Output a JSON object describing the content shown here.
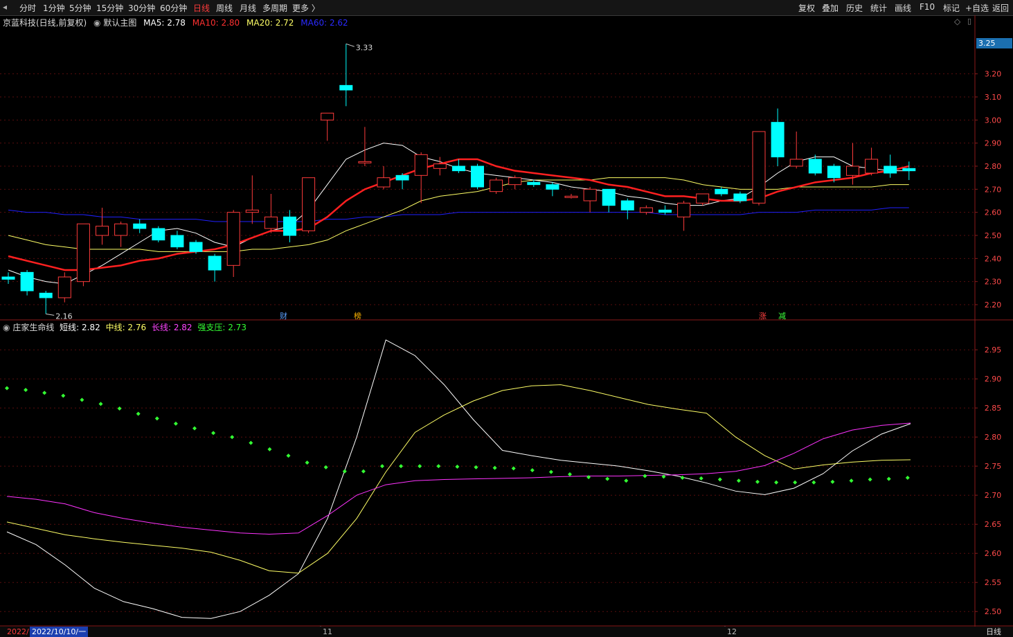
{
  "toolbar": {
    "left_items": [
      "分时",
      "1分钟",
      "5分钟",
      "15分钟",
      "30分钟",
      "60分钟",
      "日线",
      "周线",
      "月线",
      "多周期",
      "更多 〉"
    ],
    "active_item": "日线",
    "right_items": [
      "复权",
      "叠加",
      "历史",
      "统计",
      "画线",
      "F10",
      "标记",
      "+自选",
      "返回"
    ]
  },
  "main_panel": {
    "stock": "京蓝科技(日线,前复权)",
    "template": "默认主图",
    "ma5_label": "MA5: 2.78",
    "ma10_label": "MA10: 2.80",
    "ma20_label": "MA20: 2.72",
    "ma60_label": "MA60: 2.62",
    "high_mark": "3.33",
    "low_mark": "2.16",
    "price_tag": "3.25",
    "badges": [
      {
        "text": "财",
        "color": "#5aa0ff"
      },
      {
        "text": "榜",
        "color": "#ffb400"
      },
      {
        "text": "涨",
        "color": "#ff4040"
      },
      {
        "text": "减",
        "color": "#3cff3c"
      }
    ]
  },
  "sub_panel": {
    "indicator": "庄家生命线",
    "short_label": "短线: 2.82",
    "mid_label": "中线: 2.76",
    "long_label": "长线: 2.82",
    "support_label": "强支压: 2.73"
  },
  "bottom": {
    "date_start": "2022/",
    "date_cursor": "2022/10/10/一",
    "month_11": "11",
    "month_12": "12",
    "period": "日线"
  },
  "colors": {
    "up": "#ff3b3b",
    "down": "#00ffff",
    "ma5": "#ffffff",
    "ma10": "#ff2020",
    "ma20": "#ffff66",
    "ma60": "#2020ff",
    "long": "#ff33ff",
    "support": "#33ff33"
  },
  "chart_data": [
    {
      "type": "candlestick",
      "title": "京蓝科技(日线,前复权)",
      "y_ticks": [
        3.2,
        3.1,
        3.0,
        2.9,
        2.8,
        2.7,
        2.6,
        2.5,
        2.4,
        2.3,
        2.2
      ],
      "ylim": [
        2.14,
        3.4
      ],
      "candles": [
        {
          "o": 2.32,
          "c": 2.31,
          "h": 2.34,
          "l": 2.29
        },
        {
          "o": 2.34,
          "c": 2.26,
          "h": 2.35,
          "l": 2.24
        },
        {
          "o": 2.25,
          "c": 2.23,
          "h": 2.26,
          "l": 2.16
        },
        {
          "o": 2.23,
          "c": 2.32,
          "h": 2.34,
          "l": 2.21
        },
        {
          "o": 2.3,
          "c": 2.55,
          "h": 2.55,
          "l": 2.28
        },
        {
          "o": 2.5,
          "c": 2.54,
          "h": 2.62,
          "l": 2.46
        },
        {
          "o": 2.5,
          "c": 2.55,
          "h": 2.56,
          "l": 2.45
        },
        {
          "o": 2.55,
          "c": 2.53,
          "h": 2.57,
          "l": 2.51
        },
        {
          "o": 2.53,
          "c": 2.48,
          "h": 2.54,
          "l": 2.47
        },
        {
          "o": 2.5,
          "c": 2.45,
          "h": 2.52,
          "l": 2.44
        },
        {
          "o": 2.47,
          "c": 2.43,
          "h": 2.48,
          "l": 2.42
        },
        {
          "o": 2.41,
          "c": 2.35,
          "h": 2.42,
          "l": 2.3
        },
        {
          "o": 2.37,
          "c": 2.6,
          "h": 2.61,
          "l": 2.32
        },
        {
          "o": 2.6,
          "c": 2.61,
          "h": 2.76,
          "l": 2.55
        },
        {
          "o": 2.53,
          "c": 2.58,
          "h": 2.68,
          "l": 2.51
        },
        {
          "o": 2.58,
          "c": 2.5,
          "h": 2.61,
          "l": 2.47
        },
        {
          "o": 2.52,
          "c": 2.75,
          "h": 2.75,
          "l": 2.51
        },
        {
          "o": 3.0,
          "c": 3.03,
          "h": 3.03,
          "l": 2.91
        },
        {
          "o": 3.15,
          "c": 3.13,
          "h": 3.33,
          "l": 3.06
        },
        {
          "o": 2.82,
          "c": 2.82,
          "h": 2.97,
          "l": 2.8
        },
        {
          "o": 2.71,
          "c": 2.75,
          "h": 2.8,
          "l": 2.7
        },
        {
          "o": 2.76,
          "c": 2.74,
          "h": 2.77,
          "l": 2.7
        },
        {
          "o": 2.76,
          "c": 2.85,
          "h": 2.86,
          "l": 2.64
        },
        {
          "o": 2.79,
          "c": 2.81,
          "h": 2.84,
          "l": 2.76
        },
        {
          "o": 2.8,
          "c": 2.78,
          "h": 2.83,
          "l": 2.77
        },
        {
          "o": 2.8,
          "c": 2.71,
          "h": 2.81,
          "l": 2.7
        },
        {
          "o": 2.69,
          "c": 2.74,
          "h": 2.75,
          "l": 2.68
        },
        {
          "o": 2.72,
          "c": 2.75,
          "h": 2.76,
          "l": 2.7
        },
        {
          "o": 2.73,
          "c": 2.72,
          "h": 2.74,
          "l": 2.71
        },
        {
          "o": 2.72,
          "c": 2.7,
          "h": 2.73,
          "l": 2.67
        },
        {
          "o": 2.67,
          "c": 2.67,
          "h": 2.68,
          "l": 2.66
        },
        {
          "o": 2.65,
          "c": 2.7,
          "h": 2.71,
          "l": 2.6
        },
        {
          "o": 2.7,
          "c": 2.63,
          "h": 2.7,
          "l": 2.6
        },
        {
          "o": 2.65,
          "c": 2.61,
          "h": 2.66,
          "l": 2.57
        },
        {
          "o": 2.6,
          "c": 2.62,
          "h": 2.63,
          "l": 2.59
        },
        {
          "o": 2.61,
          "c": 2.6,
          "h": 2.63,
          "l": 2.59
        },
        {
          "o": 2.58,
          "c": 2.64,
          "h": 2.65,
          "l": 2.52
        },
        {
          "o": 2.64,
          "c": 2.68,
          "h": 2.68,
          "l": 2.63
        },
        {
          "o": 2.7,
          "c": 2.68,
          "h": 2.71,
          "l": 2.67
        },
        {
          "o": 2.68,
          "c": 2.65,
          "h": 2.69,
          "l": 2.64
        },
        {
          "o": 2.64,
          "c": 2.95,
          "h": 2.95,
          "l": 2.63
        },
        {
          "o": 2.99,
          "c": 2.84,
          "h": 3.05,
          "l": 2.8
        },
        {
          "o": 2.8,
          "c": 2.83,
          "h": 2.95,
          "l": 2.79
        },
        {
          "o": 2.83,
          "c": 2.77,
          "h": 2.85,
          "l": 2.76
        },
        {
          "o": 2.8,
          "c": 2.75,
          "h": 2.81,
          "l": 2.73
        },
        {
          "o": 2.76,
          "c": 2.8,
          "h": 2.9,
          "l": 2.72
        },
        {
          "o": 2.77,
          "c": 2.83,
          "h": 2.88,
          "l": 2.76
        },
        {
          "o": 2.8,
          "c": 2.77,
          "h": 2.85,
          "l": 2.75
        },
        {
          "o": 2.79,
          "c": 2.78,
          "h": 2.82,
          "l": 2.74
        }
      ],
      "ma5": [
        2.35,
        2.32,
        2.3,
        2.29,
        2.33,
        2.37,
        2.42,
        2.47,
        2.52,
        2.53,
        2.51,
        2.47,
        2.45,
        2.49,
        2.52,
        2.54,
        2.61,
        2.72,
        2.83,
        2.87,
        2.9,
        2.89,
        2.84,
        2.82,
        2.79,
        2.77,
        2.76,
        2.75,
        2.74,
        2.73,
        2.71,
        2.7,
        2.69,
        2.67,
        2.66,
        2.64,
        2.63,
        2.63,
        2.65,
        2.66,
        2.71,
        2.77,
        2.82,
        2.84,
        2.84,
        2.8,
        2.79,
        2.78,
        2.78
      ],
      "ma10": [
        2.41,
        2.39,
        2.37,
        2.35,
        2.35,
        2.36,
        2.37,
        2.39,
        2.4,
        2.42,
        2.43,
        2.44,
        2.46,
        2.49,
        2.52,
        2.52,
        2.53,
        2.58,
        2.65,
        2.7,
        2.73,
        2.76,
        2.79,
        2.81,
        2.83,
        2.83,
        2.8,
        2.78,
        2.77,
        2.76,
        2.75,
        2.74,
        2.72,
        2.71,
        2.69,
        2.67,
        2.67,
        2.66,
        2.65,
        2.65,
        2.66,
        2.69,
        2.71,
        2.73,
        2.74,
        2.75,
        2.77,
        2.78,
        2.8
      ],
      "ma20": [
        2.5,
        2.48,
        2.46,
        2.45,
        2.44,
        2.44,
        2.44,
        2.44,
        2.43,
        2.43,
        2.43,
        2.43,
        2.43,
        2.44,
        2.44,
        2.45,
        2.46,
        2.48,
        2.52,
        2.55,
        2.58,
        2.61,
        2.65,
        2.67,
        2.68,
        2.69,
        2.71,
        2.73,
        2.74,
        2.74,
        2.74,
        2.74,
        2.75,
        2.75,
        2.75,
        2.75,
        2.74,
        2.72,
        2.71,
        2.7,
        2.7,
        2.7,
        2.71,
        2.71,
        2.71,
        2.71,
        2.71,
        2.72,
        2.72
      ],
      "ma60": [
        2.61,
        2.6,
        2.6,
        2.59,
        2.59,
        2.58,
        2.58,
        2.57,
        2.57,
        2.57,
        2.57,
        2.56,
        2.56,
        2.56,
        2.56,
        2.56,
        2.56,
        2.57,
        2.57,
        2.58,
        2.58,
        2.59,
        2.59,
        2.59,
        2.6,
        2.6,
        2.6,
        2.6,
        2.6,
        2.6,
        2.6,
        2.6,
        2.6,
        2.6,
        2.6,
        2.59,
        2.59,
        2.59,
        2.59,
        2.59,
        2.6,
        2.6,
        2.6,
        2.61,
        2.61,
        2.61,
        2.61,
        2.62,
        2.62
      ]
    },
    {
      "type": "line",
      "title": "庄家生命线",
      "y_ticks": [
        2.95,
        2.9,
        2.85,
        2.8,
        2.75,
        2.7,
        2.65,
        2.6,
        2.55,
        2.5
      ],
      "ylim": [
        2.48,
        2.98
      ],
      "series": [
        {
          "name": "短线",
          "values": [
            2.637,
            2.615,
            2.58,
            2.54,
            2.517,
            2.505,
            2.49,
            2.488,
            2.5,
            2.528,
            2.565,
            2.66,
            2.8,
            2.967,
            2.94,
            2.89,
            2.83,
            2.777,
            2.768,
            2.76,
            2.755,
            2.75,
            2.742,
            2.733,
            2.721,
            2.707,
            2.701,
            2.712,
            2.737,
            2.776,
            2.805,
            2.823
          ]
        },
        {
          "name": "中线",
          "values": [
            2.654,
            2.643,
            2.632,
            2.625,
            2.619,
            2.614,
            2.609,
            2.602,
            2.588,
            2.57,
            2.566,
            2.6,
            2.66,
            2.74,
            2.808,
            2.838,
            2.862,
            2.88,
            2.888,
            2.89,
            2.88,
            2.868,
            2.856,
            2.848,
            2.841,
            2.8,
            2.768,
            2.745,
            2.752,
            2.757,
            2.76,
            2.761
          ]
        },
        {
          "name": "长线",
          "values": [
            2.698,
            2.693,
            2.685,
            2.67,
            2.66,
            2.652,
            2.645,
            2.64,
            2.635,
            2.633,
            2.635,
            2.665,
            2.7,
            2.718,
            2.725,
            2.727,
            2.728,
            2.729,
            2.73,
            2.732,
            2.733,
            2.733,
            2.734,
            2.735,
            2.737,
            2.741,
            2.751,
            2.772,
            2.797,
            2.812,
            2.82,
            2.824
          ]
        },
        {
          "name": "强支压",
          "values": [
            2.884,
            2.881,
            2.876,
            2.871,
            2.864,
            2.857,
            2.849,
            2.84,
            2.832,
            2.823,
            2.815,
            2.807,
            2.8,
            2.79,
            2.779,
            2.768,
            2.756,
            2.748,
            2.741,
            2.741,
            2.75,
            2.75,
            2.75,
            2.75,
            2.749,
            2.748,
            2.747,
            2.746,
            2.743,
            2.74,
            2.736,
            2.731,
            2.728,
            2.725,
            2.733,
            2.732,
            2.73,
            2.729,
            2.727,
            2.725,
            2.723,
            2.722,
            2.722,
            2.722,
            2.723,
            2.725,
            2.727,
            2.728,
            2.73
          ]
        }
      ]
    }
  ]
}
